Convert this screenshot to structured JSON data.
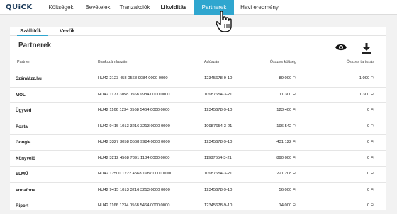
{
  "app": {
    "logo": "QUiCK"
  },
  "nav": [
    {
      "label": "Költségek"
    },
    {
      "label": "Bevételek"
    },
    {
      "label": "Tranzakciók"
    },
    {
      "label": "Likviditás"
    },
    {
      "label": "Partnerek"
    },
    {
      "label": "Havi eredmény"
    }
  ],
  "tabs": [
    {
      "label": "Szállítók"
    },
    {
      "label": "Vevők"
    }
  ],
  "page": {
    "title": "Partnerek"
  },
  "table": {
    "headers": {
      "partner": "Partner",
      "account": "Bankszámlaszám",
      "tax": "Adószám",
      "cost": "Összes költség",
      "debt": "Összes tartozás"
    },
    "rows": [
      {
        "partner": "Számlázz.hu",
        "account": "HU42 2123 458 0568 9984 0000 0000",
        "tax": "12345678-9-10",
        "cost": "89 000 Ft",
        "debt": "1 000 Ft"
      },
      {
        "partner": "MOL",
        "account": "HU42 1177 3058 0568 9984 0000 0000",
        "tax": "10987654-3-21",
        "cost": "11 300 Ft",
        "debt": "1 300 Ft"
      },
      {
        "partner": "Ügyvéd",
        "account": "HU42 1166 1234 0568 5464 0000 0000",
        "tax": "12345678-9-10",
        "cost": "123 400 Ft",
        "debt": "0 Ft"
      },
      {
        "partner": "Posta",
        "account": "HU42 9415 1013 3216 3213 0000 0000",
        "tax": "10987654-3-21",
        "cost": "196 542 Ft",
        "debt": "0 Ft"
      },
      {
        "partner": "Google",
        "account": "HU42 3327 3058 0568 9984 0000 0000",
        "tax": "12345678-9-10",
        "cost": "431 122 Ft",
        "debt": "0 Ft"
      },
      {
        "partner": "Könyvelő",
        "account": "HU42 3212 4568 7891 1134 0000 0000",
        "tax": "11987654-3-21",
        "cost": "890 000 Ft",
        "debt": "0 Ft"
      },
      {
        "partner": "ELMŰ",
        "account": "HU42 12500 1222 4568 1987 0000 0000",
        "tax": "10987654-3-21",
        "cost": "221 208 Ft",
        "debt": "0 Ft"
      },
      {
        "partner": "Vodafone",
        "account": "HU42 9415 1013 3216 3213 0000 0000",
        "tax": "12345678-9-10",
        "cost": "56 000 Ft",
        "debt": "0 Ft"
      },
      {
        "partner": "Riport",
        "account": "HU42 1166 1234 0568 5464 0000 0000",
        "tax": "12345678-9-10",
        "cost": "14 000 Ft",
        "debt": "0 Ft"
      }
    ]
  },
  "icons": {
    "view": "eye-icon",
    "download": "download-icon",
    "cursor": "hand-pointer-icon"
  },
  "colors": {
    "accent": "#2fa6cf",
    "brand": "#1d3b5a"
  }
}
